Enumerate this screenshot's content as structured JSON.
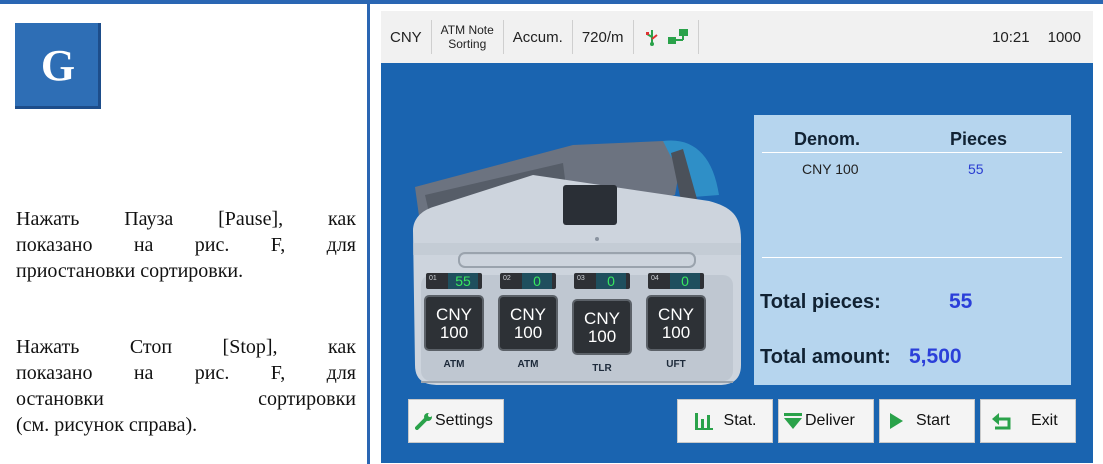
{
  "left": {
    "badge": "G",
    "para1": [
      "Нажать Пауза [Pause], как",
      "показано на рис. F, для",
      "приостановки сортировки."
    ],
    "para2": [
      "Нажать Стоп [Stop], как",
      "показано на рис. F, для",
      "остановки сортировки",
      "(см. рисунок справа)."
    ]
  },
  "status": {
    "currency": "CNY",
    "mode_line1": "ATM Note",
    "mode_line2": "Sorting",
    "accum": "Accum.",
    "speed": "720/m",
    "time": "10:21",
    "batch": "1000",
    "icons": [
      "usb-icon",
      "network-icon"
    ]
  },
  "pockets": [
    {
      "num": "01",
      "count": "55",
      "denom_line1": "CNY",
      "denom_line2": "100",
      "label": "ATM"
    },
    {
      "num": "02",
      "count": "0",
      "denom_line1": "CNY",
      "denom_line2": "100",
      "label": "ATM"
    },
    {
      "num": "03",
      "count": "0",
      "denom_line1": "CNY",
      "denom_line2": "100",
      "label": "TLR"
    },
    {
      "num": "04",
      "count": "0",
      "denom_line1": "CNY",
      "denom_line2": "100",
      "label": "UFT"
    }
  ],
  "table": {
    "col_denom": "Denom.",
    "col_pieces": "Pieces",
    "rows": [
      {
        "denom": "CNY 100",
        "pieces": "55"
      }
    ],
    "total_pieces_label": "Total pieces:",
    "total_pieces": "55",
    "total_amount_label": "Total amount:",
    "total_amount": "5,500"
  },
  "buttons": {
    "settings": "Settings",
    "stat": "Stat.",
    "deliver": "Deliver",
    "start": "Start",
    "exit": "Exit"
  },
  "colors": {
    "screen_bg": "#1a64b0",
    "panel_bg": "#b6d5ee",
    "value_blue": "#2b3fd9",
    "counter_green": "#38e85f",
    "badge_blue": "#2e6eb5"
  }
}
